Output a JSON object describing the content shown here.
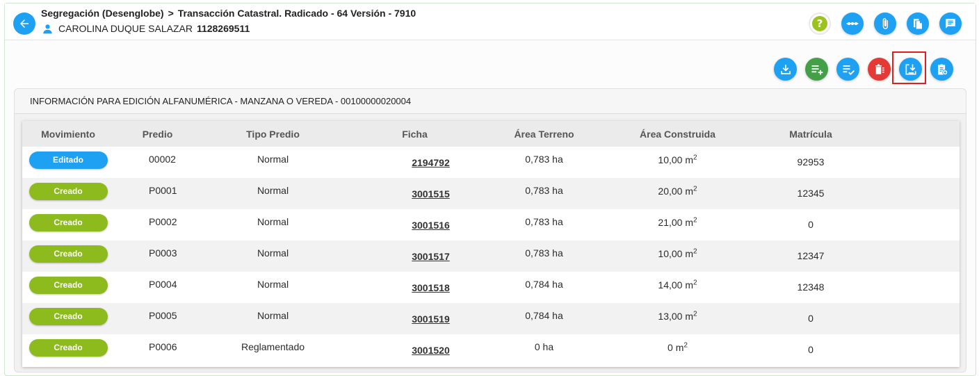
{
  "header": {
    "crumb_1": "Segregación (Desenglobe)",
    "crumb_sep": ">",
    "crumb_2": "Transacción Catastral. Radicado - 64 Versión - 7910",
    "user_name": "CAROLINA DUQUE SALAZAR",
    "user_id": "1128269511",
    "help_label": "?"
  },
  "panel": {
    "title": "INFORMACIÓN PARA EDICIÓN ALFANUMÉRICA - MANZANA O VEREDA - 00100000020004"
  },
  "table": {
    "columns": [
      "Movimiento",
      "Predio",
      "Tipo Predio",
      "Ficha",
      "Área Terreno",
      "Área Construida",
      "Matrícula"
    ],
    "unit": "m",
    "unit_exp": "2",
    "rows": [
      {
        "mov": "Editado",
        "predio": "00002",
        "tipo": "Normal",
        "ficha": "2194792",
        "terreno": "0,783 ha",
        "construida": "10,00",
        "matricula": "92953"
      },
      {
        "mov": "Creado",
        "predio": "P0001",
        "tipo": "Normal",
        "ficha": "3001515",
        "terreno": "0,783 ha",
        "construida": "20,00",
        "matricula": "12345"
      },
      {
        "mov": "Creado",
        "predio": "P0002",
        "tipo": "Normal",
        "ficha": "3001516",
        "terreno": "0,783 ha",
        "construida": "21,00",
        "matricula": "0"
      },
      {
        "mov": "Creado",
        "predio": "P0003",
        "tipo": "Normal",
        "ficha": "3001517",
        "terreno": "0,783 ha",
        "construida": "10,00",
        "matricula": "12347"
      },
      {
        "mov": "Creado",
        "predio": "P0004",
        "tipo": "Normal",
        "ficha": "3001518",
        "terreno": "0,784 ha",
        "construida": "14,00",
        "matricula": "12348"
      },
      {
        "mov": "Creado",
        "predio": "P0005",
        "tipo": "Normal",
        "ficha": "3001519",
        "terreno": "0,784 ha",
        "construida": "13,00",
        "matricula": "0"
      },
      {
        "mov": "Creado",
        "predio": "P0006",
        "tipo": "Reglamentado",
        "ficha": "3001520",
        "terreno": "0 ha",
        "construida": "0",
        "matricula": "0"
      }
    ]
  },
  "colors": {
    "primary": "#1ea1f2",
    "success": "#43a047",
    "danger": "#e53935",
    "created": "#8dbb1e",
    "highlight": "#e11d1d"
  },
  "icons": {
    "header": [
      "help-icon",
      "flow-icon",
      "attachment-icon",
      "copy-document-icon",
      "notes-icon"
    ],
    "toolbar": [
      "download-icon",
      "add-list-icon",
      "check-list-icon",
      "delete-list-icon",
      "import-icon",
      "clipboard-add-icon"
    ]
  }
}
